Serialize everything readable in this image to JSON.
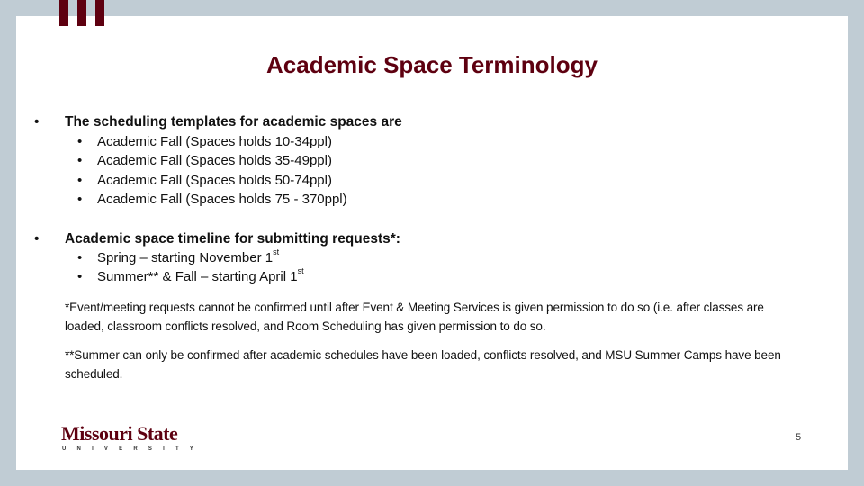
{
  "slide": {
    "title": "Academic Space Terminology",
    "sections": [
      {
        "heading": "The scheduling templates for academic spaces are",
        "items": [
          "Academic Fall (Spaces holds 10-34ppl)",
          "Academic Fall (Spaces holds 35-49ppl)",
          "Academic Fall (Spaces holds 50-74ppl)",
          "Academic Fall (Spaces holds 75 - 370ppl)"
        ]
      },
      {
        "heading": "Academic space timeline for submitting requests*:",
        "items": [
          {
            "text": "Spring – starting November 1",
            "sup": "st"
          },
          {
            "text": "Summer** & Fall – starting April 1",
            "sup": "st"
          }
        ]
      }
    ],
    "notes": [
      "*Event/meeting requests cannot be confirmed until after Event & Meeting Services is given permission to do so (i.e. after classes are loaded, classroom conflicts resolved, and Room Scheduling has given permission to do so.",
      "**Summer can only be confirmed after academic schedules have been loaded, conflicts resolved, and MSU Summer Camps have been scheduled."
    ],
    "bullet": "•",
    "logo": {
      "name": "Missouri State",
      "subtitle": "UNIVERSITY"
    },
    "page_number": "5"
  },
  "colors": {
    "brand_maroon": "#5e0010",
    "background": "#c0ccd4",
    "slide": "#ffffff"
  }
}
